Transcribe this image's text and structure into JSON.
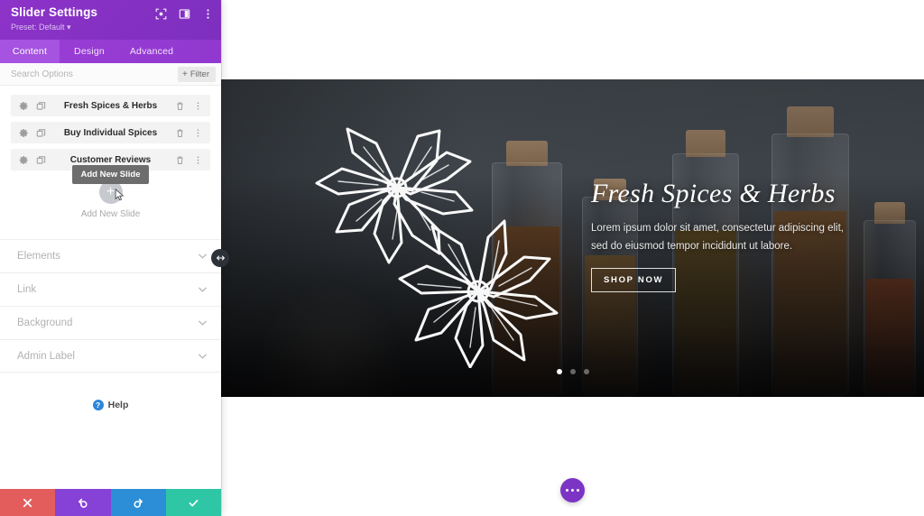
{
  "panel": {
    "title": "Slider Settings",
    "preset": "Preset: Default ",
    "preset_caret": "▾",
    "header_icons": [
      "focus-icon",
      "layout-icon",
      "more-vertical-icon"
    ],
    "tabs": [
      {
        "label": "Content",
        "active": true
      },
      {
        "label": "Design",
        "active": false
      },
      {
        "label": "Advanced",
        "active": false
      }
    ],
    "search": {
      "placeholder": "Search Options",
      "value": ""
    },
    "filter": {
      "label": "Filter",
      "plus": "+"
    },
    "slides": [
      {
        "name": "Fresh Spices & Herbs"
      },
      {
        "name": "Buy Individual Spices"
      },
      {
        "name": "Customer Reviews"
      }
    ],
    "add_slide": {
      "label": "Add New Slide",
      "tooltip": "Add New Slide",
      "plus": "+"
    },
    "accordion": [
      {
        "label": "Elements"
      },
      {
        "label": "Link"
      },
      {
        "label": "Background"
      },
      {
        "label": "Admin Label"
      }
    ],
    "help": {
      "badge": "?",
      "label": "Help"
    },
    "footer": [
      {
        "name": "cancel-button",
        "icon": "close-icon",
        "color": "#e35d5d"
      },
      {
        "name": "undo-button",
        "icon": "undo-icon",
        "color": "#8641d6"
      },
      {
        "name": "redo-button",
        "icon": "redo-icon",
        "color": "#2c8ed6"
      },
      {
        "name": "save-button",
        "icon": "check-icon",
        "color": "#2fc6a5"
      }
    ]
  },
  "hero": {
    "title": "Fresh Spices & Herbs",
    "subtitle_line1": "Lorem ipsum dolor sit amet, consectetur adipiscing elit,",
    "subtitle_line2": "sed do eiusmod tempor incididunt ut labore.",
    "button": "SHOP NOW",
    "dots": [
      {
        "active": true
      },
      {
        "active": false
      },
      {
        "active": false
      }
    ]
  },
  "colors": {
    "panel_header": "#8b33c7",
    "tab_bar": "#9a3fd6",
    "tab_active": "#a553e0",
    "arrow": "#ec3d8c",
    "fab": "#7b34c4"
  }
}
